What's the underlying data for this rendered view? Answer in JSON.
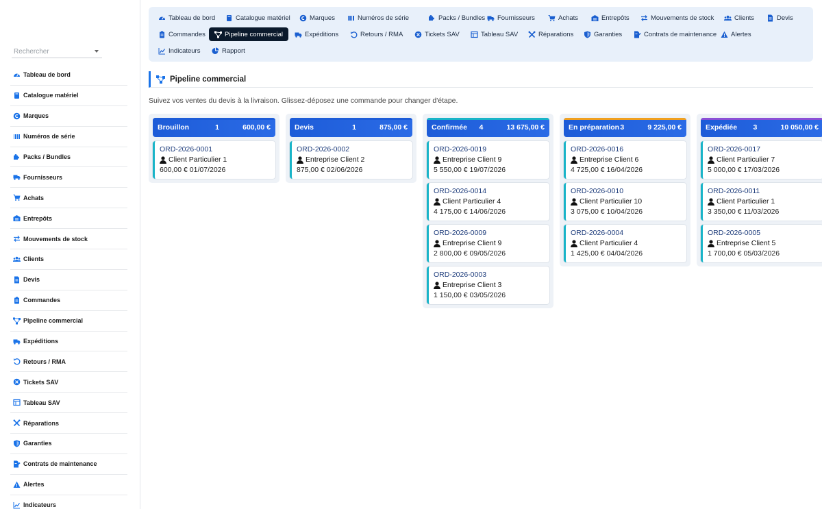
{
  "search": {
    "placeholder": "Rechercher"
  },
  "sidebar": {
    "items": [
      {
        "label": "Tableau de bord",
        "icon": "gauge-icon"
      },
      {
        "label": "Catalogue matériel",
        "icon": "book-icon"
      },
      {
        "label": "Marques",
        "icon": "copyright-icon"
      },
      {
        "label": "Numéros de série",
        "icon": "barcode-icon"
      },
      {
        "label": "Packs / Bundles",
        "icon": "puzzle-icon"
      },
      {
        "label": "Fournisseurs",
        "icon": "truck-icon"
      },
      {
        "label": "Achats",
        "icon": "cart-icon"
      },
      {
        "label": "Entrepôts",
        "icon": "warehouse-icon"
      },
      {
        "label": "Mouvements de stock",
        "icon": "exchange-icon"
      },
      {
        "label": "Clients",
        "icon": "users-icon"
      },
      {
        "label": "Devis",
        "icon": "file-icon"
      },
      {
        "label": "Commandes",
        "icon": "clipboard-icon"
      },
      {
        "label": "Pipeline commercial",
        "icon": "pipeline-icon"
      },
      {
        "label": "Expéditions",
        "icon": "shipping-icon"
      },
      {
        "label": "Retours / RMA",
        "icon": "undo-icon"
      },
      {
        "label": "Tickets SAV",
        "icon": "ticket-icon"
      },
      {
        "label": "Tableau SAV",
        "icon": "table-icon"
      },
      {
        "label": "Réparations",
        "icon": "tools-icon"
      },
      {
        "label": "Garanties",
        "icon": "shield-icon"
      },
      {
        "label": "Contrats de maintenance",
        "icon": "contract-icon"
      },
      {
        "label": "Alertes",
        "icon": "warning-icon"
      },
      {
        "label": "Indicateurs",
        "icon": "chart-icon"
      }
    ]
  },
  "topnav": {
    "items": [
      {
        "label": "Tableau de bord",
        "icon": "gauge-icon"
      },
      {
        "label": "Catalogue matériel",
        "icon": "book-icon"
      },
      {
        "label": "Marques",
        "icon": "copyright-icon"
      },
      {
        "label": "Numéros de série",
        "icon": "barcode-icon"
      },
      {
        "label": "Packs / Bundles",
        "icon": "puzzle-icon"
      },
      {
        "label": "Fournisseurs",
        "icon": "truck-icon"
      },
      {
        "label": "Achats",
        "icon": "cart-icon"
      },
      {
        "label": "Entrepôts",
        "icon": "warehouse-icon"
      },
      {
        "label": "Mouvements de stock",
        "icon": "exchange-icon"
      },
      {
        "label": "Clients",
        "icon": "users-icon"
      },
      {
        "label": "Devis",
        "icon": "file-icon"
      },
      {
        "label": "Commandes",
        "icon": "clipboard-icon"
      },
      {
        "label": "Pipeline commercial",
        "icon": "pipeline-icon"
      },
      {
        "label": "Expéditions",
        "icon": "shipping-icon"
      },
      {
        "label": "Retours / RMA",
        "icon": "undo-icon"
      },
      {
        "label": "Tickets SAV",
        "icon": "ticket-icon"
      },
      {
        "label": "Tableau SAV",
        "icon": "table-icon"
      },
      {
        "label": "Réparations",
        "icon": "tools-icon"
      },
      {
        "label": "Garanties",
        "icon": "shield-icon"
      },
      {
        "label": "Contrats de maintenance",
        "icon": "contract-icon"
      },
      {
        "label": "Alertes",
        "icon": "warning-icon"
      },
      {
        "label": "Indicateurs",
        "icon": "chart-icon"
      },
      {
        "label": "Rapport",
        "icon": "pie-icon"
      }
    ],
    "active": "Pipeline commercial"
  },
  "page": {
    "title": "Pipeline commercial",
    "subtitle": "Suivez vos ventes du devis à la livraison. Glissez-déposez une commande pour changer d'étape."
  },
  "colors": {
    "accent": "#1a73e8",
    "column_header": "#1d5cd8",
    "card_border": "#19b4c8",
    "nav_background": "#e8f0fa",
    "active_nav": "#0b1a2c"
  },
  "columns": [
    {
      "name": "Brouillon",
      "count": "1",
      "total": "600,00 €",
      "stripe": "#1d5cd8",
      "cards": [
        {
          "id": "ORD-2026-0001",
          "client": "Client Particulier 1",
          "meta": "600,00 € 01/07/2026"
        }
      ]
    },
    {
      "name": "Devis",
      "count": "1",
      "total": "875,00 €",
      "stripe": "#1d5cd8",
      "cards": [
        {
          "id": "ORD-2026-0002",
          "client": "Entreprise Client 2",
          "meta": "875,00 € 02/06/2026"
        }
      ]
    },
    {
      "name": "Confirmée",
      "count": "4",
      "total": "13 675,00 €",
      "stripe": "#19b4c8",
      "cards": [
        {
          "id": "ORD-2026-0019",
          "client": "Entreprise Client 9",
          "meta": "5 550,00 € 19/07/2026"
        },
        {
          "id": "ORD-2026-0014",
          "client": "Client Particulier 4",
          "meta": "4 175,00 € 14/06/2026"
        },
        {
          "id": "ORD-2026-0009",
          "client": "Entreprise Client 9",
          "meta": "2 800,00 € 09/05/2026"
        },
        {
          "id": "ORD-2026-0003",
          "client": "Entreprise Client 3",
          "meta": "1 150,00 € 03/05/2026"
        }
      ]
    },
    {
      "name": "En préparation",
      "count": "3",
      "total": "9 225,00 €",
      "stripe": "#f0a020",
      "cards": [
        {
          "id": "ORD-2026-0016",
          "client": "Entreprise Client 6",
          "meta": "4 725,00 € 16/04/2026"
        },
        {
          "id": "ORD-2026-0010",
          "client": "Client Particulier 10",
          "meta": "3 075,00 € 10/04/2026"
        },
        {
          "id": "ORD-2026-0004",
          "client": "Client Particulier 4",
          "meta": "1 425,00 € 04/04/2026"
        }
      ]
    },
    {
      "name": "Expédiée",
      "count": "3",
      "total": "10 050,00 €",
      "stripe": "#8a4fd6",
      "cards": [
        {
          "id": "ORD-2026-0017",
          "client": "Client Particulier 7",
          "meta": "5 000,00 € 17/03/2026"
        },
        {
          "id": "ORD-2026-0011",
          "client": "Client Particulier 1",
          "meta": "3 350,00 € 11/03/2026"
        },
        {
          "id": "ORD-2026-0005",
          "client": "Entreprise Client 5",
          "meta": "1 700,00 € 05/03/2026"
        }
      ]
    }
  ]
}
